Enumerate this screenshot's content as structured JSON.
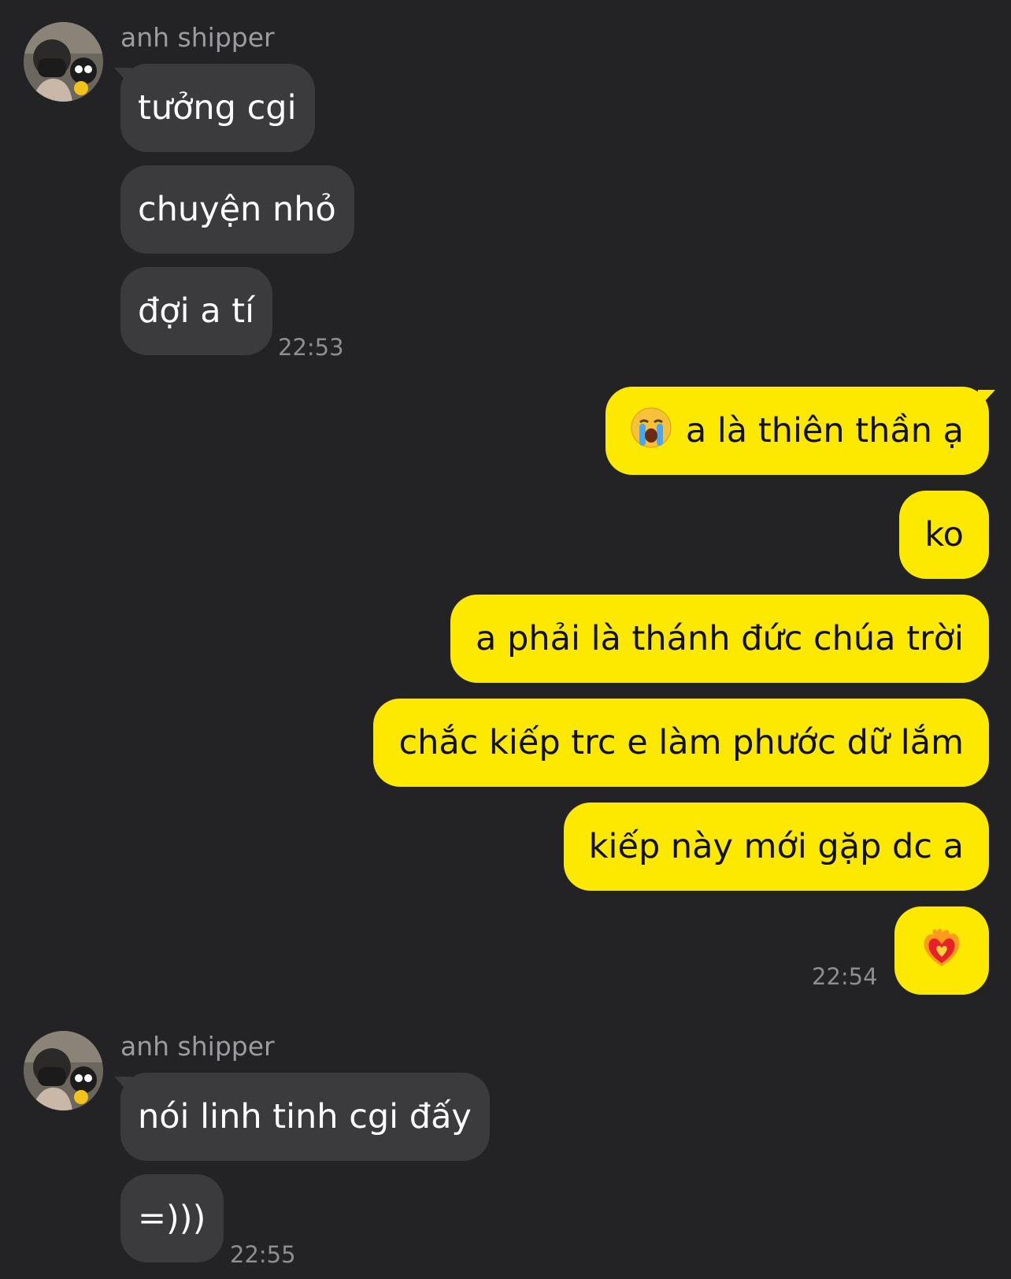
{
  "group1": {
    "sender": "anh shipper",
    "messages": [
      "tưởng cgi",
      "chuyện nhỏ",
      "đợi a tí"
    ],
    "time": "22:53"
  },
  "group2": {
    "messages": [
      {
        "emoji": "crying-face",
        "text": "a là thiên thần ạ"
      },
      {
        "text": "ko"
      },
      {
        "text": "a phải là thánh đức chúa trời"
      },
      {
        "text": "chắc kiếp trc e làm phước dữ lắm"
      },
      {
        "text": "kiếp này mới gặp dc a"
      },
      {
        "emoji": "heart-on-fire"
      }
    ],
    "time": "22:54"
  },
  "group3": {
    "sender": "anh shipper",
    "messages": [
      "nói linh tinh cgi đấy",
      "=)))"
    ],
    "time": "22:55"
  },
  "colors": {
    "background": "#232325",
    "incoming_bubble": "#3b3b3e",
    "outgoing_bubble": "#fde800"
  }
}
